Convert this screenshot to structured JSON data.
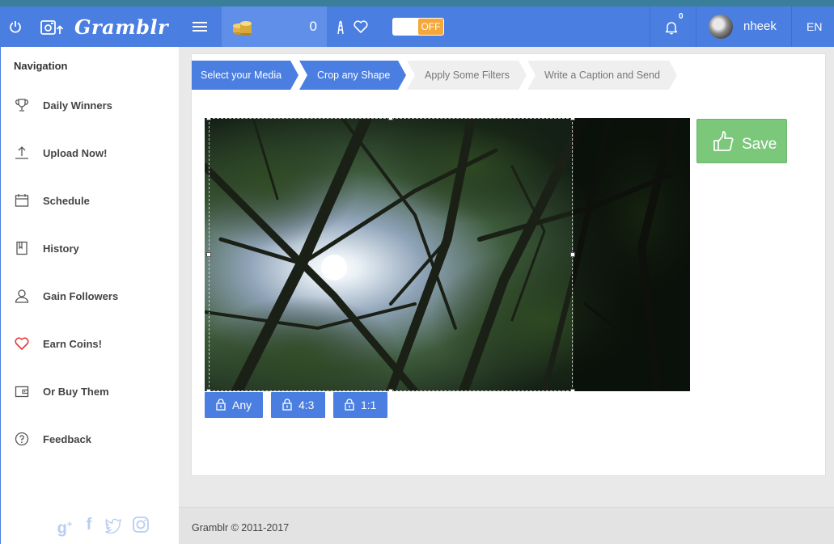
{
  "header": {
    "brand": "Gramblr",
    "coin_count": "0",
    "toggle_label": "OFF",
    "notification_count": "0",
    "username": "nheek",
    "language": "EN"
  },
  "sidebar": {
    "title": "Navigation",
    "items": [
      {
        "label": "Daily Winners",
        "icon": "trophy-icon"
      },
      {
        "label": "Upload Now!",
        "icon": "upload-icon"
      },
      {
        "label": "Schedule",
        "icon": "calendar-icon"
      },
      {
        "label": "History",
        "icon": "book-icon"
      },
      {
        "label": "Gain Followers",
        "icon": "user-icon"
      },
      {
        "label": "Earn Coins!",
        "icon": "heart-icon"
      },
      {
        "label": "Or Buy Them",
        "icon": "wallet-icon"
      },
      {
        "label": "Feedback",
        "icon": "help-icon"
      }
    ],
    "socials": [
      "google-plus-icon",
      "facebook-icon",
      "twitter-icon",
      "instagram-icon"
    ]
  },
  "wizard": {
    "steps": [
      {
        "label": "Select your Media",
        "state": "done"
      },
      {
        "label": "Crop any Shape",
        "state": "active"
      },
      {
        "label": "Apply Some Filters",
        "state": "pending"
      },
      {
        "label": "Write a Caption and Send",
        "state": "pending"
      }
    ]
  },
  "editor": {
    "save_label": "Save",
    "ratios": [
      {
        "label": "Any"
      },
      {
        "label": "4:3"
      },
      {
        "label": "1:1"
      }
    ]
  },
  "footer": {
    "copyright": "Gramblr © 2011-2017"
  },
  "colors": {
    "accent": "#4a7ee0",
    "save": "#7bc87b",
    "toggle": "#f5a73a",
    "heart": "#e23b3b"
  }
}
